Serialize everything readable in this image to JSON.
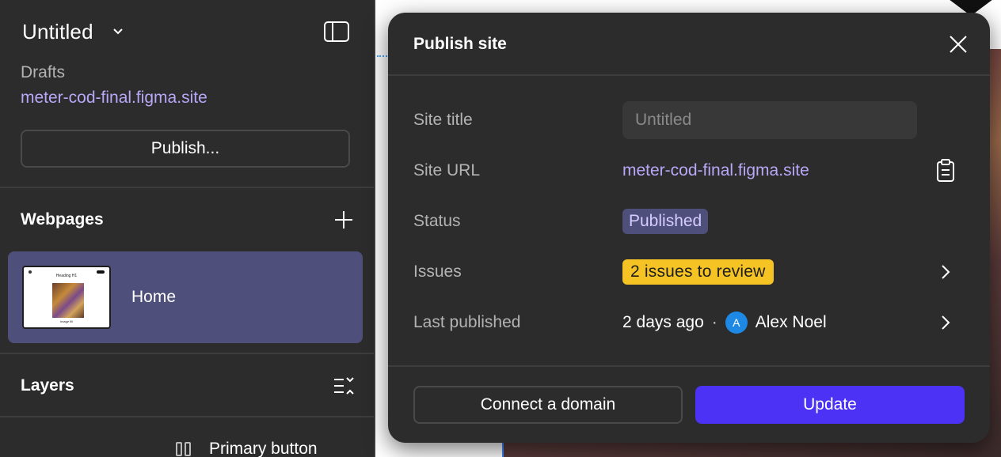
{
  "sidebar": {
    "file_title": "Untitled",
    "file_menu_icon": "chevron-down-icon",
    "panel_icon": "sidebar-toggle-icon",
    "drafts_label": "Drafts",
    "site_link": "meter-cod-final.figma.site",
    "publish_button": "Publish...",
    "webpages_title": "Webpages",
    "add_icon": "plus-icon",
    "pages": [
      {
        "name": "Home",
        "thumbnail": {
          "heading": "Heading H1",
          "caption": "Image fill"
        }
      }
    ],
    "layers_title": "Layers",
    "layers_icon": "collapse-layers-icon",
    "layers": [
      {
        "label": "Primary button",
        "icon": "layout-columns-icon"
      }
    ]
  },
  "modal": {
    "title": "Publish site",
    "close_icon": "close-icon",
    "fields": {
      "site_title_label": "Site title",
      "site_title_placeholder": "Untitled",
      "site_url_label": "Site URL",
      "site_url": "meter-cod-final.figma.site",
      "copy_icon": "clipboard-icon",
      "status_label": "Status",
      "status_value": "Published",
      "issues_label": "Issues",
      "issues_value": "2 issues to review",
      "last_published_label": "Last published",
      "last_published_time": "2 days ago",
      "separator": "·",
      "author_initial": "A",
      "author_name": "Alex Noel"
    },
    "buttons": {
      "connect_domain": "Connect a domain",
      "update": "Update"
    }
  },
  "colors": {
    "panel_bg": "#2c2c2c",
    "accent_purple": "#b9a7f7",
    "selected_bg": "#4f4f7c",
    "warning_yellow": "#f5c324",
    "primary_button": "#4b32f5",
    "avatar_blue": "#1e88e5"
  }
}
